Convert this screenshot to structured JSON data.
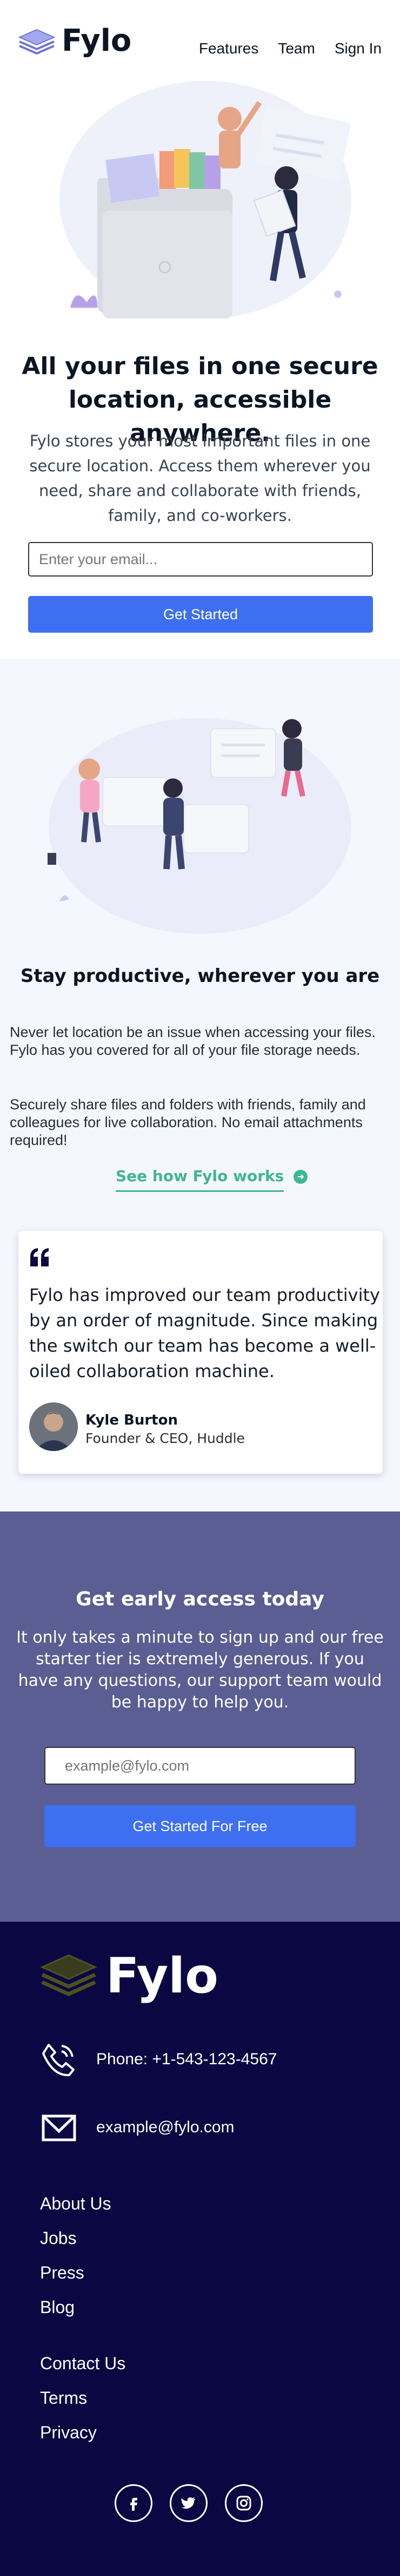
{
  "header": {
    "logo_text": "Fylo",
    "nav": [
      "Features",
      "Team",
      "Sign In"
    ]
  },
  "hero": {
    "title": "All your files in one secure location, accessible anywhere.",
    "text": "Fylo stores your most important files in one secure location. Access them wherever you need, share and collaborate with friends, family, and co-workers.",
    "email_placeholder": "Enter your email...",
    "cta_label": "Get Started"
  },
  "productive": {
    "title": "Stay productive, wherever you are",
    "p1": "Never let location be an issue when accessing your files. Fylo has you covered for all of your file storage needs.",
    "p2": "Securely share files and folders with friends, family and colleagues for live collaboration. No email attachments required!",
    "link_label": "See how Fylo works"
  },
  "testimonial": {
    "quote": "Fylo has improved our team productivity by an order of magnitude. Since making the switch our team has become a well-oiled collaboration machine.",
    "name": "Kyle Burton",
    "role": "Founder & CEO, Huddle"
  },
  "early_access": {
    "title": "Get early access today",
    "text": "It only takes a minute to sign up and our free starter tier is extremely generous. If you have any questions, our support team would be happy to help you.",
    "email_placeholder": "example@fylo.com",
    "cta_label": "Get Started For Free"
  },
  "footer": {
    "logo_text": "Fylo",
    "phone": "Phone: +1-543-123-4567",
    "email": "example@fylo.com",
    "links_col1": [
      "About Us",
      "Jobs",
      "Press",
      "Blog"
    ],
    "links_col2": [
      "Contact Us",
      "Terms",
      "Privacy"
    ],
    "social_icons": [
      "facebook-icon",
      "twitter-icon",
      "instagram-icon"
    ]
  },
  "colors": {
    "accent_blue": "#3d6ff0",
    "teal": "#3fb595",
    "early_bg": "#5a5e92",
    "footer_bg": "#0b0742"
  }
}
